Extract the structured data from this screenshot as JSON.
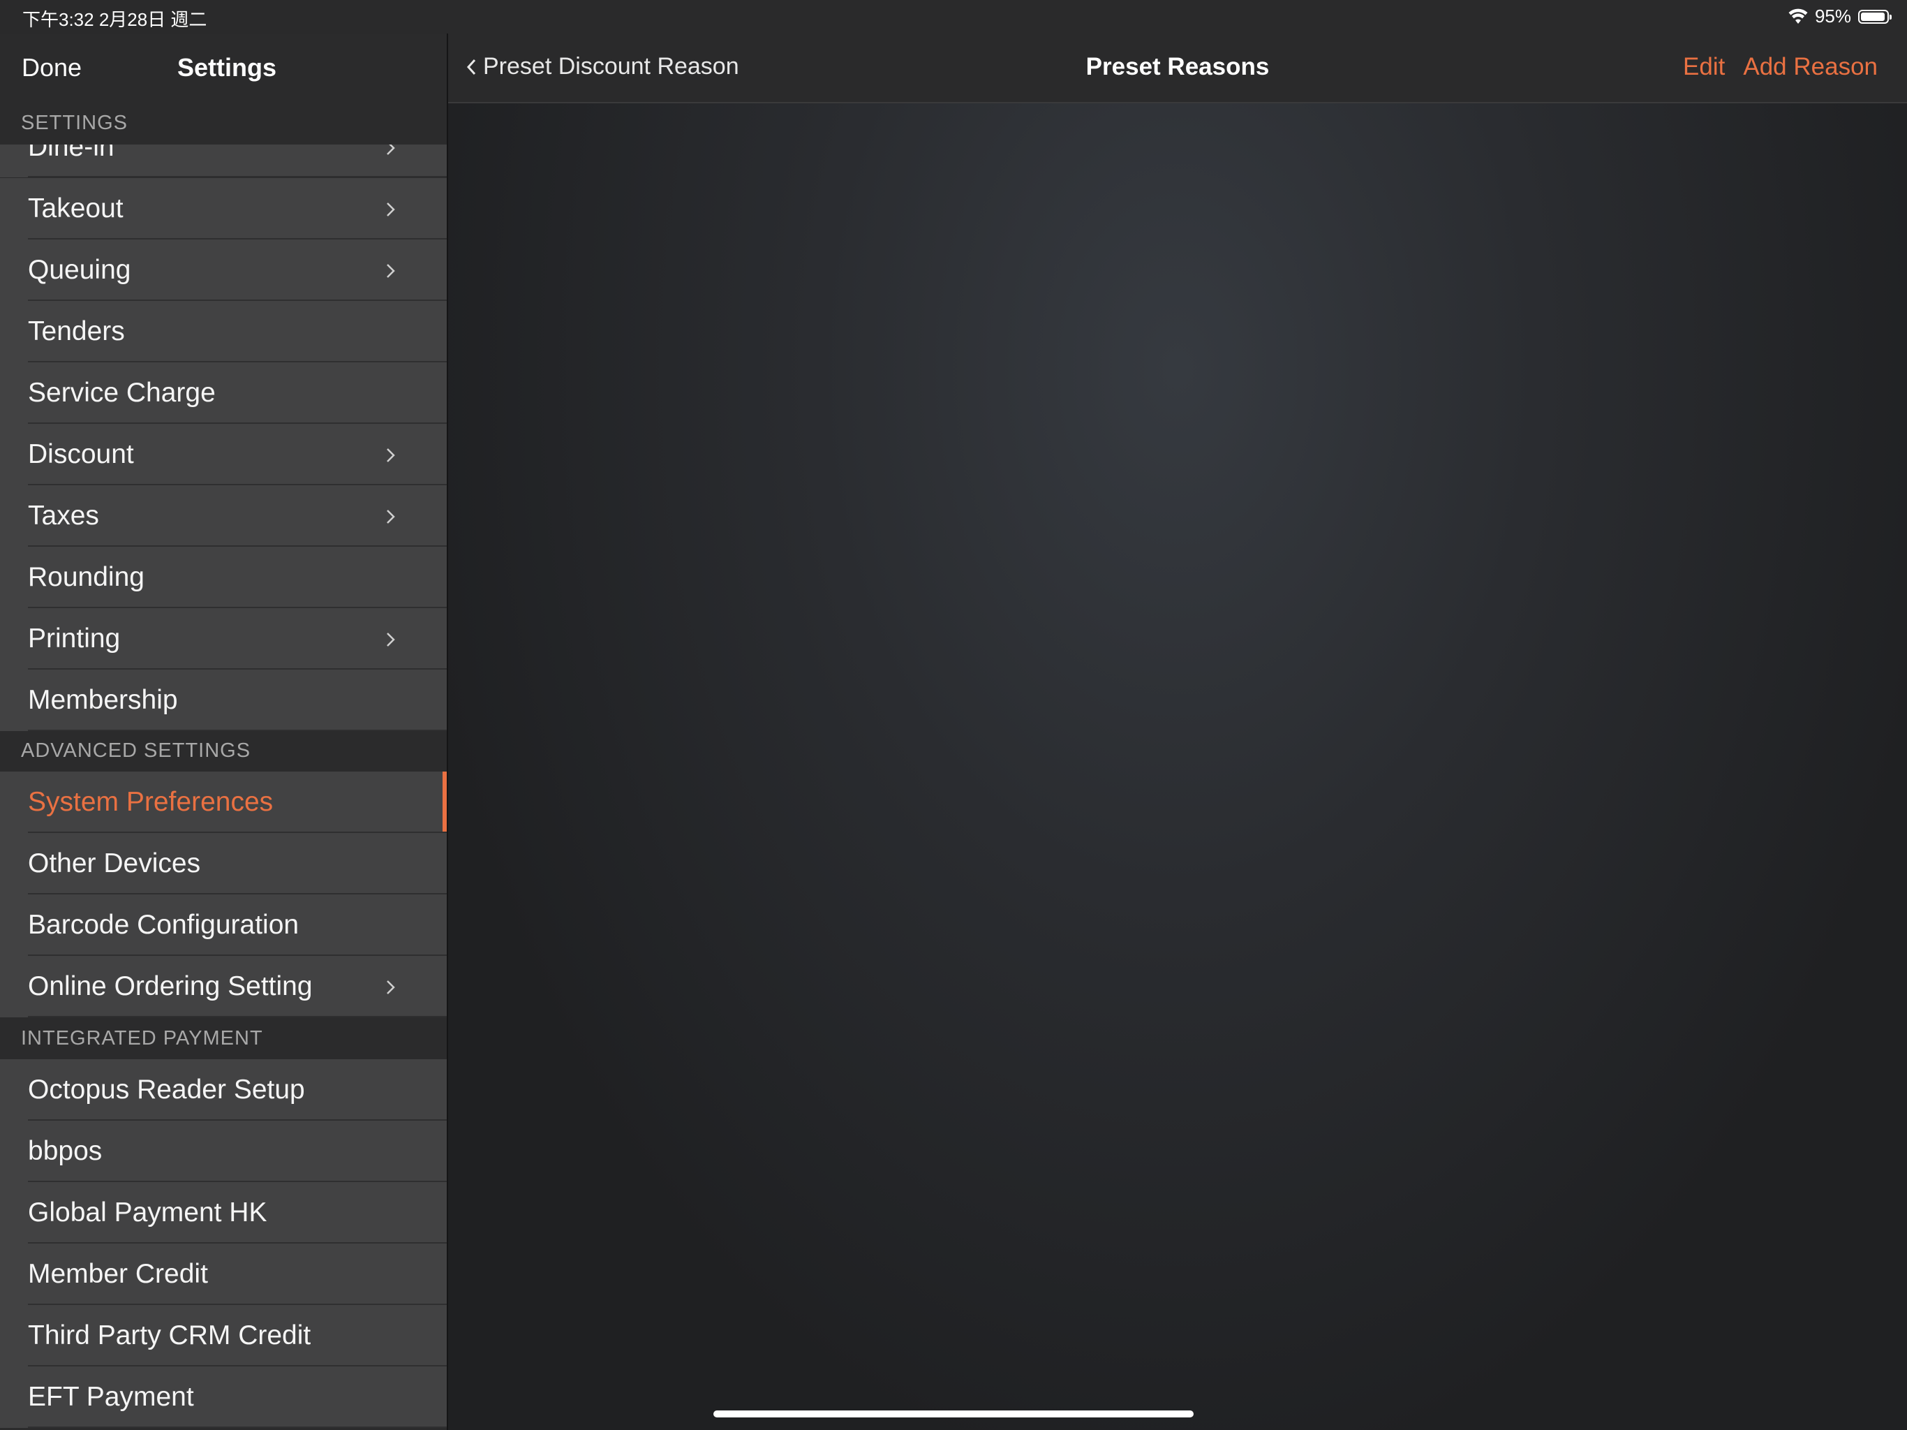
{
  "status_bar": {
    "time": "下午3:32   2月28日 週二",
    "battery": "95%",
    "battery_level": 0.95
  },
  "sidebar": {
    "done_label": "Done",
    "title": "Settings",
    "sections": [
      {
        "header": "SETTINGS"
      },
      {
        "header": "ADVANCED SETTINGS"
      },
      {
        "header": "INTEGRATED PAYMENT"
      }
    ],
    "partial_item": "Dine-in",
    "settings_items": [
      {
        "label": "Takeout",
        "chevron": true
      },
      {
        "label": "Queuing",
        "chevron": true
      },
      {
        "label": "Tenders",
        "chevron": false
      },
      {
        "label": "Service Charge",
        "chevron": false
      },
      {
        "label": "Discount",
        "chevron": true
      },
      {
        "label": "Taxes",
        "chevron": true
      },
      {
        "label": "Rounding",
        "chevron": false
      },
      {
        "label": "Printing",
        "chevron": true
      },
      {
        "label": "Membership",
        "chevron": false
      }
    ],
    "advanced_items": [
      {
        "label": "System Preferences",
        "chevron": false,
        "selected": true
      },
      {
        "label": "Other Devices",
        "chevron": false
      },
      {
        "label": "Barcode Configuration",
        "chevron": false
      },
      {
        "label": "Online Ordering Setting",
        "chevron": true
      }
    ],
    "payment_items": [
      {
        "label": "Octopus Reader Setup",
        "chevron": false
      },
      {
        "label": "bbpos",
        "chevron": false
      },
      {
        "label": "Global Payment HK",
        "chevron": false
      },
      {
        "label": "Member Credit",
        "chevron": false
      },
      {
        "label": "Third Party CRM Credit",
        "chevron": false
      },
      {
        "label": "EFT Payment",
        "chevron": false
      }
    ]
  },
  "main": {
    "back_label": "Preset Discount Reason",
    "title": "Preset Reasons",
    "edit_label": "Edit",
    "add_label": "Add Reason"
  },
  "colors": {
    "accent": "#ea7142",
    "row_bg": "#424243",
    "sidebar_bg": "#2b2b2c",
    "content_bg": "#1f2022"
  },
  "icons": {
    "wifi": "wifi-icon",
    "battery": "battery-icon",
    "chevron": "chevron-right-icon",
    "back": "chevron-left-icon"
  }
}
